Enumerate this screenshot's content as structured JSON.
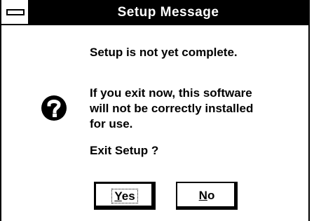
{
  "window": {
    "title": "Setup Message"
  },
  "message": {
    "line1": "Setup is not yet complete.",
    "line2": "If you exit now, this software\nwill not be correctly installed\nfor use.",
    "line3": "Exit Setup ?"
  },
  "icon": {
    "name": "question-icon"
  },
  "buttons": {
    "yes_mnemonic": "Y",
    "yes_rest": "es",
    "no_mnemonic": "N",
    "no_rest": "o"
  }
}
